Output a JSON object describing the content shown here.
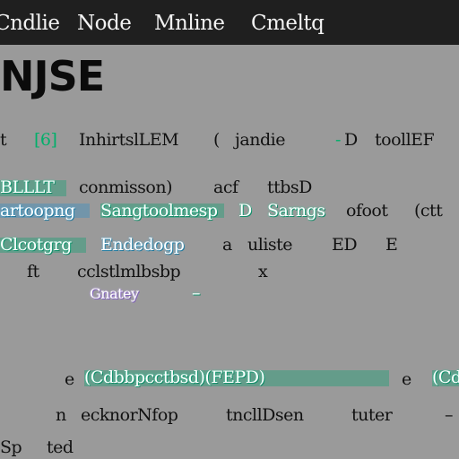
{
  "menubar": {
    "items": [
      "Cndlie",
      "Node",
      "Mnline",
      "Cmeltq"
    ]
  },
  "title": "NJSE",
  "rows": [
    {
      "texts": [
        "t",
        "[6]",
        "InhirtslLEM",
        "(",
        "jandie",
        "-",
        "D",
        "toollEF"
      ]
    },
    {
      "texts": [
        "BLLLT",
        "conmisson)",
        "acf",
        "ttbsD"
      ]
    },
    {
      "texts": [
        "artoopng",
        "Sangtoolmesp",
        "D",
        "Sarngs",
        "ofoot",
        "(ctt"
      ]
    },
    {
      "texts": [
        "Clcotgrg",
        "Endedogp",
        "a",
        "uliste",
        "ED",
        "E"
      ]
    },
    {
      "texts": [
        "ft",
        "cclstlmlbsbp",
        "x"
      ]
    },
    {
      "texts": [
        "Gnatey",
        "–"
      ]
    },
    {
      "texts": [
        "e",
        "(Cdbbpcctbsd)(FEPD)",
        "e",
        "(Cdrt"
      ]
    },
    {
      "texts": [
        "n",
        "ecknorNfop",
        "tncllDsen",
        "tuter",
        "–"
      ]
    },
    {
      "texts": [
        "Sp",
        "ted"
      ]
    }
  ]
}
